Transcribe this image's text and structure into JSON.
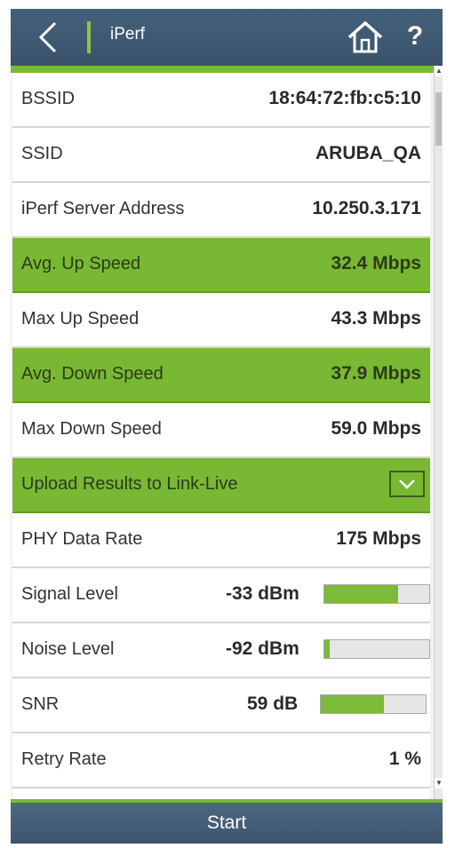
{
  "header": {
    "title": "iPerf",
    "back_icon": "chevron-left-icon",
    "home_icon": "home-icon",
    "help_label": "?"
  },
  "rows": [
    {
      "label": "BSSID",
      "value": "18:64:72:fb:c5:10",
      "highlight": false
    },
    {
      "label": "SSID",
      "value": "ARUBA_QA",
      "highlight": false
    },
    {
      "label": "iPerf Server Address",
      "value": "10.250.3.171",
      "highlight": false
    },
    {
      "label": "Avg. Up Speed",
      "value": "32.4 Mbps",
      "highlight": true
    },
    {
      "label": "Max Up Speed",
      "value": "43.3 Mbps",
      "highlight": false
    },
    {
      "label": "Avg. Down Speed",
      "value": "37.9 Mbps",
      "highlight": true
    },
    {
      "label": "Max Down Speed",
      "value": "59.0 Mbps",
      "highlight": false
    }
  ],
  "upload": {
    "label": "Upload Results to Link-Live",
    "dropdown_icon": "chevron-down-icon"
  },
  "phy": {
    "label": "PHY Data Rate",
    "value": "175 Mbps"
  },
  "meters": [
    {
      "label": "Signal Level",
      "value": "-33 dBm",
      "level": 0.7
    },
    {
      "label": "Noise Level",
      "value": "-92 dBm",
      "level": 0.05
    },
    {
      "label": "SNR",
      "value": "59 dB",
      "level": 0.6
    }
  ],
  "retry": {
    "label": "Retry Rate",
    "value": "1 %"
  },
  "footer": {
    "start_label": "Start"
  },
  "colors": {
    "accent_green": "#79b833",
    "header_blue": "#3a536b",
    "meter_fill": "#7cba3a"
  }
}
